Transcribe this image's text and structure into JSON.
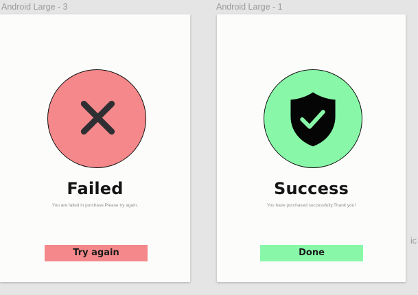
{
  "canvas": {
    "background": "#e5e5e5",
    "edge_label": "ic"
  },
  "frames": [
    {
      "label": "Android Large - 3",
      "circle_color": "#f4888a",
      "icon": "close-icon",
      "title": "Failed",
      "subtitle": "You are failed in purchase.Please try again.",
      "button_label": "Try again",
      "button_color": "#f4888a"
    },
    {
      "label": "Android Large - 1",
      "circle_color": "#88f8a8",
      "icon": "shield-check-icon",
      "title": "Success",
      "subtitle": "You have purchased successfully.Thank you!",
      "button_label": "Done",
      "button_color": "#88f8a8"
    }
  ]
}
